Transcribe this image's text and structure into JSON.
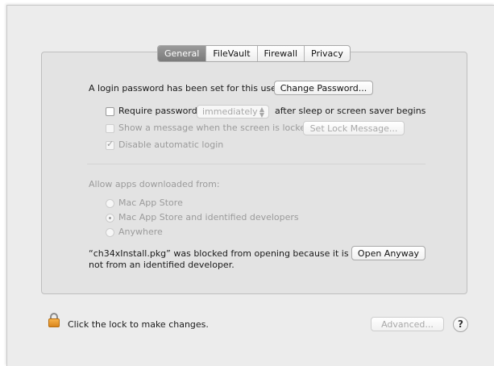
{
  "tabs": [
    {
      "label": "General",
      "active": true
    },
    {
      "label": "FileVault",
      "active": false
    },
    {
      "label": "Firewall",
      "active": false
    },
    {
      "label": "Privacy",
      "active": false
    }
  ],
  "login": {
    "text": "A login password has been set for this user",
    "change_password_label": "Change Password..."
  },
  "require_password": {
    "label": "Require password",
    "select_value": "immediately",
    "suffix": "after sleep or screen saver begins",
    "checked": false
  },
  "show_message": {
    "label": "Show a message when the screen is locked",
    "button_label": "Set Lock Message...",
    "checked": false
  },
  "disable_autologin": {
    "label": "Disable automatic login",
    "checked": true
  },
  "downloads": {
    "heading": "Allow apps downloaded from:",
    "options": [
      "Mac App Store",
      "Mac App Store and identified developers",
      "Anywhere"
    ],
    "selected_index": 1
  },
  "blocked": {
    "line1": "“ch34xInstall.pkg” was blocked from opening because it is",
    "line2": "not from an identified developer.",
    "open_anyway_label": "Open Anyway"
  },
  "footer": {
    "lock_text": "Click the lock to make changes.",
    "advanced_label": "Advanced...",
    "help_label": "?"
  },
  "icons": {
    "lock": "lock-icon",
    "help": "help-icon"
  }
}
